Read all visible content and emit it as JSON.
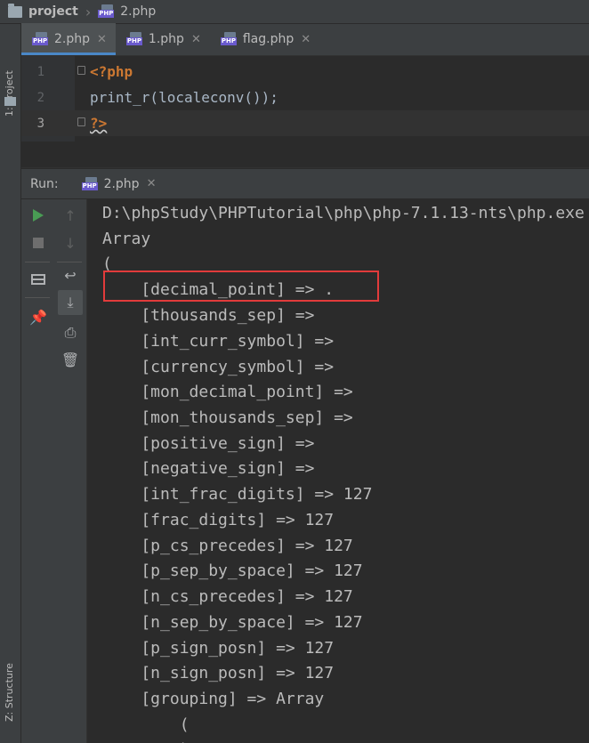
{
  "breadcrumb": {
    "project": "project",
    "file": "2.php"
  },
  "left_strip": {
    "project_tab": "1: Project",
    "structure_tab": "Z: Structure"
  },
  "tabs": [
    {
      "label": "2.php",
      "icon": "php-file-icon",
      "active": true
    },
    {
      "label": "1.php",
      "icon": "php-file-icon",
      "active": false
    },
    {
      "label": "flag.php",
      "icon": "php-file-icon",
      "active": false
    }
  ],
  "editor": {
    "lines": [
      {
        "num": "1",
        "code": "<?php"
      },
      {
        "num": "2",
        "code": "print_r(localeconv());"
      },
      {
        "num": "3",
        "code": "?>"
      }
    ]
  },
  "run": {
    "label": "Run:",
    "tab": "2.php",
    "console": [
      "D:\\phpStudy\\PHPTutorial\\php\\php-7.1.13-nts\\php.exe",
      "Array",
      "(",
      "    [decimal_point] => .",
      "    [thousands_sep] =>",
      "    [int_curr_symbol] =>",
      "    [currency_symbol] =>",
      "    [mon_decimal_point] =>",
      "    [mon_thousands_sep] =>",
      "    [positive_sign] =>",
      "    [negative_sign] =>",
      "    [int_frac_digits] => 127",
      "    [frac_digits] => 127",
      "    [p_cs_precedes] => 127",
      "    [p_sep_by_space] => 127",
      "    [n_cs_precedes] => 127",
      "    [n_sep_by_space] => 127",
      "    [p_sign_posn] => 127",
      "    [n_sign_posn] => 127",
      "    [grouping] => Array",
      "        (",
      "        )"
    ]
  },
  "colors": {
    "highlight_box": "#e23b3b",
    "php_tag": "#cc7832",
    "run_green": "#499c54",
    "tab_accent": "#4a88c7"
  }
}
